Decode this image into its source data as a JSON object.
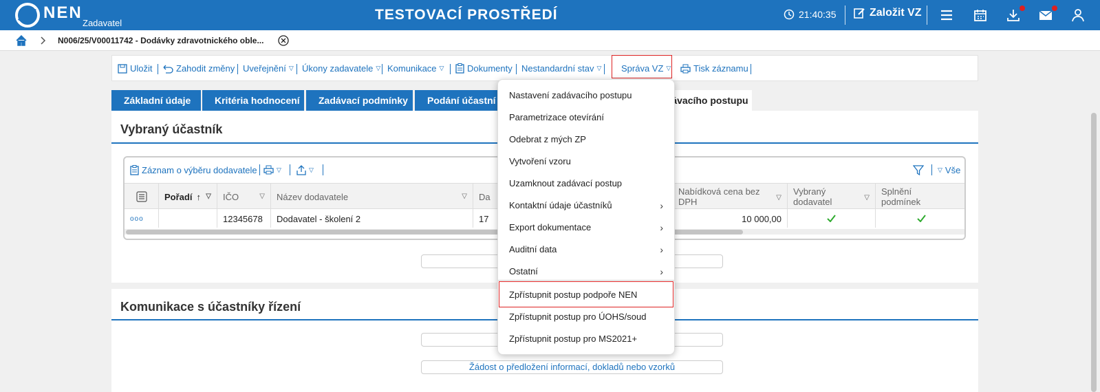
{
  "header": {
    "logo_text": "NEN",
    "logo_sub": "Zadavatel",
    "env_title": "TESTOVACÍ PROSTŘEDÍ",
    "clock": "21:40:35",
    "new_vz": "Založit VZ",
    "icons": [
      "menu-icon",
      "calendar-icon",
      "download-icon",
      "mail-icon",
      "user-icon"
    ]
  },
  "breadcrumb": {
    "text": "N006/25/V00011742 - Dodávky zdravotnického oble..."
  },
  "toolbar": {
    "items": [
      "Uložit",
      "Zahodit změny",
      "Uveřejnění",
      "Úkony zadavatele",
      "Komunikace",
      "Dokumenty",
      "Nestandardní stav",
      "Správa VZ",
      "Tisk záznamu"
    ]
  },
  "tabs": [
    "Základní údaje",
    "Kritéria hodnocení",
    "Zadávací podmínky",
    "Podání účastní",
    "zadávacího postupu"
  ],
  "panel1": {
    "title": "Vybraný účastník",
    "grid_toolbar": {
      "record": "Záznam o výběru dodavatele",
      "all": "Vše"
    },
    "headers": [
      "Pořadí",
      "IČO",
      "Název dodavatele",
      "Da",
      "Nabídková cena bez DPH",
      "Vybraný dodavatel",
      "Splnění podmínek"
    ],
    "row": {
      "menu": "ooo",
      "ico": "12345678",
      "name": "Dodavatel - školení 2",
      "da": "17",
      "partial": "0",
      "price": "10 000,00"
    }
  },
  "panel2": {
    "title": "Komunikace s účastníky řízení",
    "button": "Žádost o předložení informací, dokladů nebo vzorků"
  },
  "menu": {
    "items": [
      {
        "label": "Nastavení zadávacího postupu",
        "submenu": false
      },
      {
        "label": "Parametrizace otevírání",
        "submenu": false
      },
      {
        "label": "Odebrat z mých ZP",
        "submenu": false
      },
      {
        "label": "Vytvoření vzoru",
        "submenu": false
      },
      {
        "label": "Uzamknout zadávací postup",
        "submenu": false
      },
      {
        "label": "Kontaktní údaje účastníků",
        "submenu": true
      },
      {
        "label": "Export dokumentace",
        "submenu": true
      },
      {
        "label": "Auditní data",
        "submenu": true
      },
      {
        "label": "Ostatní",
        "submenu": true
      },
      {
        "label": "Zpřístupnit postup podpoře NEN",
        "submenu": false
      },
      {
        "label": "Zpřístupnit postup pro ÚOHS/soud",
        "submenu": false
      },
      {
        "label": "Zpřístupnit postup pro MS2021+",
        "submenu": false
      }
    ]
  },
  "colors": {
    "brand": "#1e73be",
    "highlight": "#dd2222",
    "check": "#2eaa2e"
  }
}
